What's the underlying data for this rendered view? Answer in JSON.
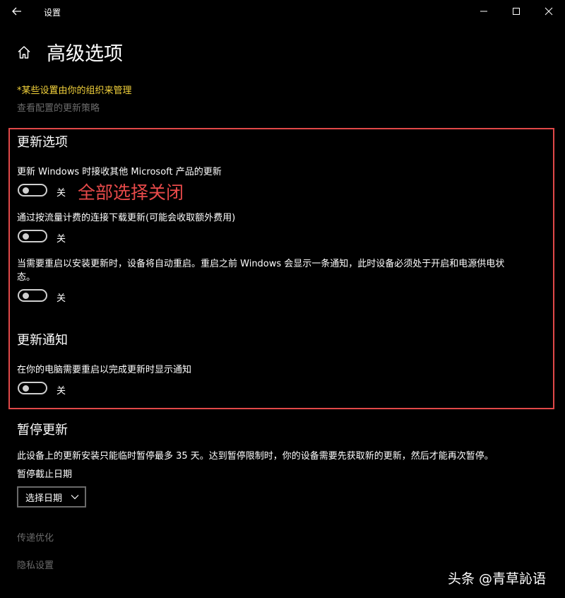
{
  "titlebar": {
    "title": "设置"
  },
  "page": {
    "title": "高级选项"
  },
  "org_note": "*某些设置由你的组织来管理",
  "policy_link": "查看配置的更新策略",
  "update_options": {
    "heading": "更新选项",
    "items": [
      {
        "label": "更新 Windows 时接收其他 Microsoft 产品的更新",
        "state": "关"
      },
      {
        "label": "通过按流量计费的连接下载更新(可能会收取额外费用)",
        "state": "关"
      },
      {
        "label": "当需要重启以安装更新时，设备将自动重启。重启之前 Windows 会显示一条通知，此时设备必须处于开启和电源供电状",
        "label_cont": "态。",
        "state": "关"
      }
    ]
  },
  "annotation": "全部选择关闭",
  "update_notifications": {
    "heading": "更新通知",
    "item": {
      "label": "在你的电脑需要重启以完成更新时显示通知",
      "state": "关"
    }
  },
  "pause_updates": {
    "heading": "暂停更新",
    "description": "此设备上的更新安装只能临时暂停最多 35 天。达到暂停限制时，你的设备需要先获取新的更新，然后才能再次暂停。",
    "date_label": "暂停截止日期",
    "dropdown_value": "选择日期"
  },
  "links": {
    "delivery_optimization": "传递优化",
    "privacy_settings": "隐私设置"
  },
  "watermark": "头条 @青草訫语",
  "colors": {
    "background": "#000000",
    "highlight": "#e04848",
    "org_note": "#f3d23b",
    "muted": "#6b6b6b"
  },
  "icons": [
    "back-arrow-icon",
    "minimize-icon",
    "maximize-icon",
    "close-icon",
    "home-icon",
    "chevron-down-icon"
  ]
}
